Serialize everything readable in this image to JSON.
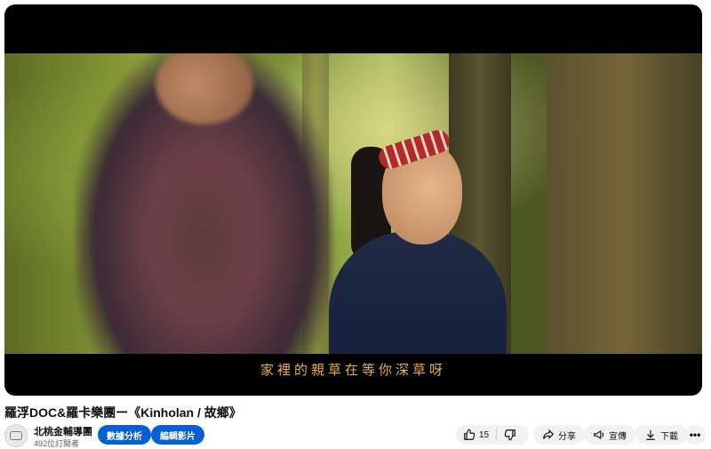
{
  "video": {
    "subtitle": "家裡的親草在等你深草呀"
  },
  "title": "羅浮DOC&羅卡樂團ー《Kinholan / 故鄉》",
  "channel": {
    "name": "北桃金輔導團",
    "subscribers": "492位訂閱者",
    "avatar_icon": "channel-logo-icon"
  },
  "actions": {
    "analytics_label": "數據分析",
    "edit_label": "編輯影片",
    "like_count": "15",
    "share_label": "分享",
    "promote_label": "宣傳",
    "download_label": "下載",
    "more_label": "•••"
  },
  "colors": {
    "primary_button": "#065fd4",
    "subtitle": "#e6b04a",
    "pill": "#f2f2f2"
  }
}
